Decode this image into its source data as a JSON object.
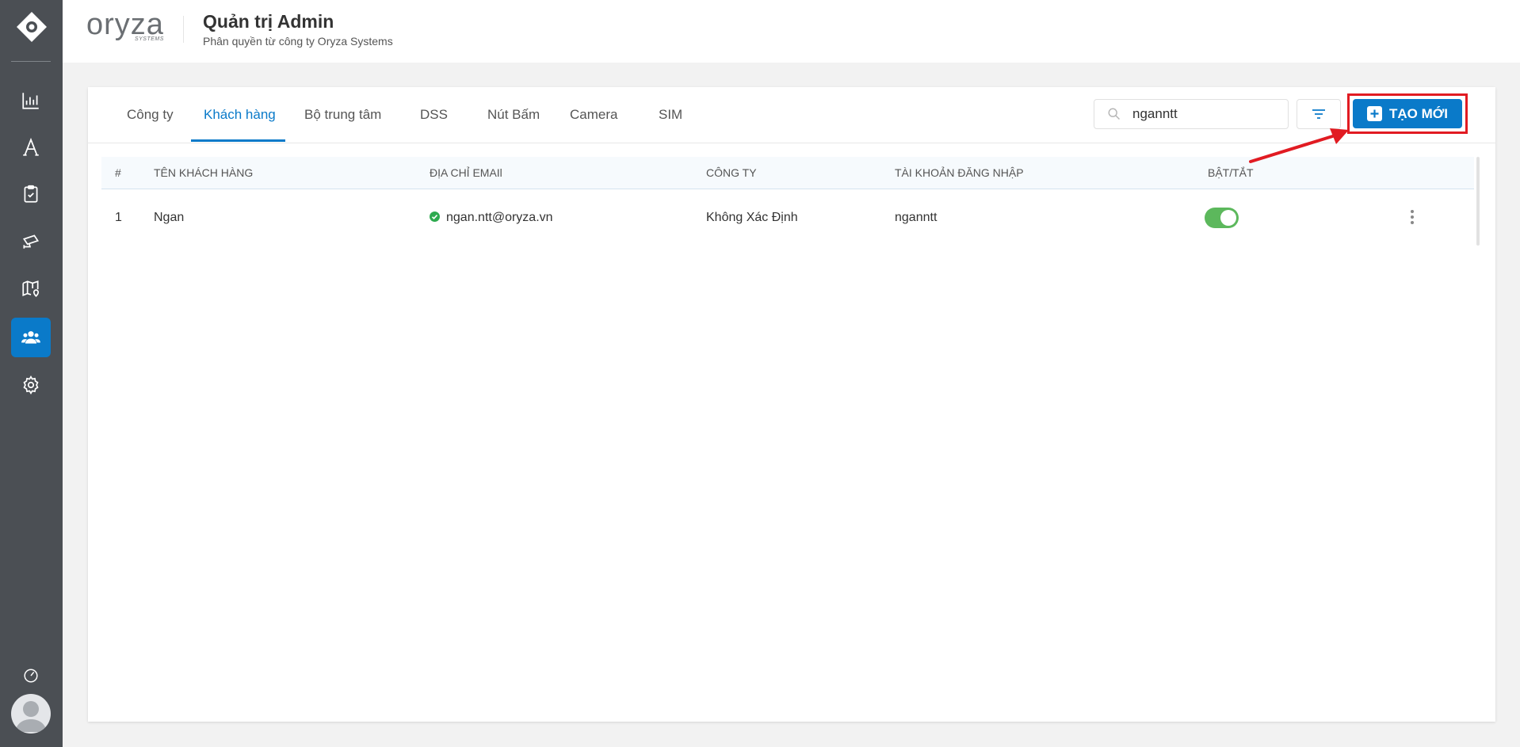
{
  "app": {
    "title": "Quản trị Admin",
    "subtitle": "Phân quyền từ công ty Oryza Systems",
    "brand_name": "oryza",
    "brand_tag": "SYSTEMS"
  },
  "sidebar": {
    "items": [
      {
        "icon": "chart-icon"
      },
      {
        "icon": "font-icon"
      },
      {
        "icon": "clipboard-check-icon"
      },
      {
        "icon": "camera-icon"
      },
      {
        "icon": "map-pin-icon"
      },
      {
        "icon": "users-icon",
        "active": true
      },
      {
        "icon": "gear-icon"
      }
    ]
  },
  "tabs": [
    "Công ty",
    "Khách hàng",
    "Bộ trung tâm",
    "DSS",
    "Nút Bấm",
    "Camera",
    "SIM"
  ],
  "active_tab": "Khách hàng",
  "search": {
    "value": "nganntt"
  },
  "create_button": {
    "label": "TẠO MỚI"
  },
  "table": {
    "columns": [
      "#",
      "TÊN KHÁCH HÀNG",
      "ĐỊA CHỈ EMAIl",
      "CÔNG TY",
      "TÀI KHOẢN ĐĂNG NHẬP",
      "BẬT/TẮT"
    ],
    "rows": [
      {
        "index": "1",
        "name": "Ngan",
        "email": "ngan.ntt@oryza.vn",
        "company": "Không Xác Định",
        "username": "nganntt",
        "enabled": true
      }
    ]
  },
  "colors": {
    "accent": "#0a7ac9",
    "sidebar": "#4b4f54",
    "annotation": "#e11b22",
    "toggle_on": "#5cb85c"
  }
}
